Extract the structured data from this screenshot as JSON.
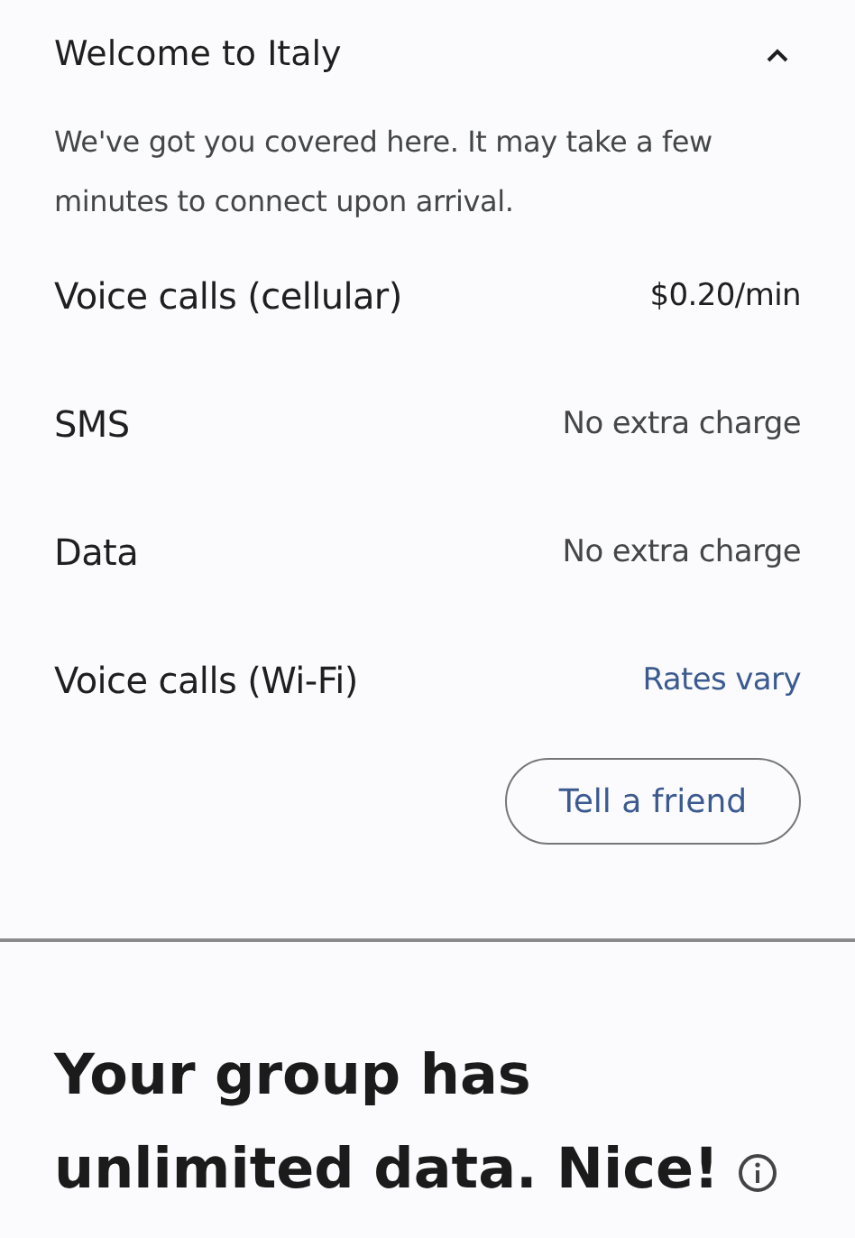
{
  "section": {
    "title": "Welcome to Italy",
    "expanded": true,
    "description": "We've got you covered here. It may take a few minutes to connect upon arrival.",
    "rates": [
      {
        "label": "Voice calls (cellular)",
        "value": "$0.20/min",
        "kind": "price"
      },
      {
        "label": "SMS",
        "value": "No extra charge",
        "kind": "note"
      },
      {
        "label": "Data",
        "value": "No extra charge",
        "kind": "note"
      },
      {
        "label": "Voice calls (Wi-Fi)",
        "value": "Rates vary",
        "kind": "link"
      }
    ],
    "button": "Tell a friend"
  },
  "headline": "Your group has unlimited data. Nice!"
}
